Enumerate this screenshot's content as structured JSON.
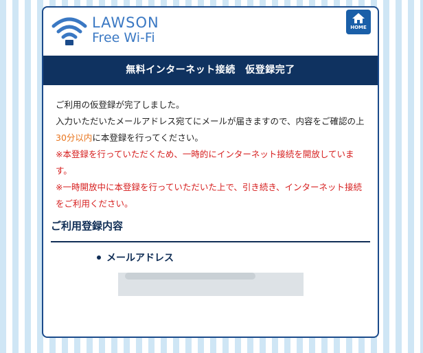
{
  "brand": {
    "line1": "LAWSON",
    "line2": "Free Wi-Fi"
  },
  "home": {
    "label": "HOME",
    "icon": "home-icon"
  },
  "title": "無料インターネット接続　仮登録完了",
  "message": {
    "line1": "ご利用の仮登録が完了しました。",
    "line2_pre": "入力いただいたメールアドレス宛てにメールが届きますので、内容をご確認の上",
    "line2_accent": "30分以内",
    "line2_post": "に本登録を行ってください。",
    "warn1": "※本登録を行っていただくため、一時的にインターネット接続を開放しています。",
    "warn2": "※一時開放中に本登録を行っていただいた上で、引き続き、インターネット接続をご利用ください。"
  },
  "section": {
    "title": "ご利用登録内容",
    "field_label": "メールアドレス",
    "field_value": ""
  },
  "colors": {
    "navy": "#0f3260",
    "brand_blue": "#3a78c3",
    "accent_orange": "#e8731b",
    "warning_red": "#d61e1e"
  }
}
